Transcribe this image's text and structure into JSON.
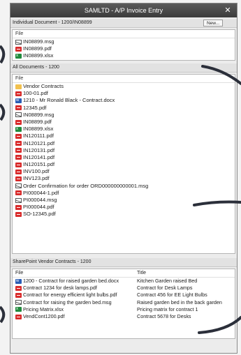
{
  "window": {
    "title": "SAMLTD - A/P Invoice Entry",
    "close_glyph": "✕"
  },
  "individual": {
    "header": "Individual Document - 1200/IN08899",
    "new_label": "New...",
    "column": "File",
    "files": [
      {
        "name": "IN08899.msg",
        "icon": "msg"
      },
      {
        "name": "IN08899.pdf",
        "icon": "pdf"
      },
      {
        "name": "IN08899.xlsx",
        "icon": "xlsx"
      }
    ]
  },
  "all_documents": {
    "header": "All Documents - 1200",
    "column": "File",
    "files": [
      {
        "name": "Vendor Contracts",
        "icon": "folder"
      },
      {
        "name": "100-01.pdf",
        "icon": "pdf"
      },
      {
        "name": "1210 - Mr Ronald Black - Contract.docx",
        "icon": "docx"
      },
      {
        "name": "12345.pdf",
        "icon": "pdf"
      },
      {
        "name": "IN08899.msg",
        "icon": "msg"
      },
      {
        "name": "IN08899.pdf",
        "icon": "pdf"
      },
      {
        "name": "IN08899.xlsx",
        "icon": "xlsx"
      },
      {
        "name": "IN120111.pdf",
        "icon": "pdf"
      },
      {
        "name": "IN120121.pdf",
        "icon": "pdf"
      },
      {
        "name": "IN120131.pdf",
        "icon": "pdf"
      },
      {
        "name": "IN120141.pdf",
        "icon": "pdf"
      },
      {
        "name": "IN120151.pdf",
        "icon": "pdf"
      },
      {
        "name": "INV100.pdf",
        "icon": "pdf"
      },
      {
        "name": "INV123.pdf",
        "icon": "pdf"
      },
      {
        "name": "Order Confirmation for order ORD000000000001.msg",
        "icon": "msg"
      },
      {
        "name": "PI000044-1.pdf",
        "icon": "pdf"
      },
      {
        "name": "PI000044.msg",
        "icon": "msg"
      },
      {
        "name": "PI000044.pdf",
        "icon": "pdf"
      },
      {
        "name": "SO-12345.pdf",
        "icon": "pdf"
      }
    ]
  },
  "sharepoint": {
    "header": "SharePoint Vendor Contracts - 1200",
    "columns": {
      "file": "File",
      "title": "Title"
    },
    "rows": [
      {
        "file": "1200 - Contract for raised garden bed.docx",
        "icon": "docx",
        "title": "Kitchen Garden raised Bed"
      },
      {
        "file": "Contract 1234 for desk lamps.pdf",
        "icon": "pdf",
        "title": "Contract for Desk Lamps"
      },
      {
        "file": "Contract for energy efficient light bulbs.pdf",
        "icon": "pdf",
        "title": "Contract 456 for EE Light Bulbs"
      },
      {
        "file": "Contract for raising the garden bed.msg",
        "icon": "msg",
        "title": "Raised garden bed in the back garden"
      },
      {
        "file": "Pricing Matrix.xlsx",
        "icon": "xlsx",
        "title": "Pricing matrix for contract 1"
      },
      {
        "file": "VendCont1200.pdf",
        "icon": "pdf",
        "title": "Contract 5678 for Desks"
      }
    ]
  }
}
